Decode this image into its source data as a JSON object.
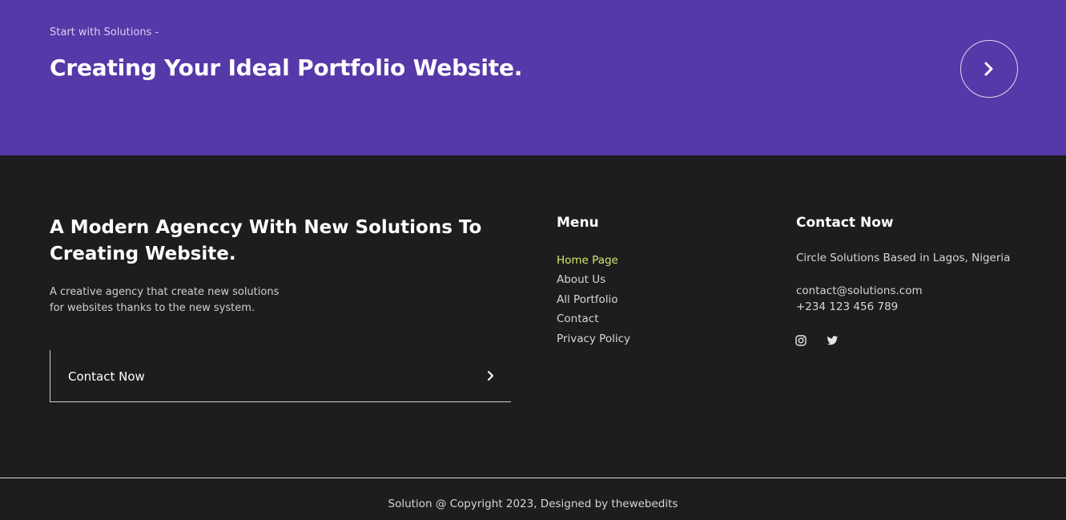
{
  "cta": {
    "eyebrow": "Start with Solutions -",
    "title": "Creating Your Ideal Portfolio Website.",
    "arrow_icon": "chevron-right-icon",
    "background_color": "#5539a8"
  },
  "about": {
    "title": "A Modern Agenccy With New Solutions To Creating Website.",
    "text_line1": "A creative agency that create new solutions",
    "text_line2": "for websites thanks to the new system.",
    "button_label": "Contact Now",
    "button_icon": "chevron-right-icon"
  },
  "menu": {
    "title": "Menu",
    "items": [
      {
        "label": "Home Page",
        "active": true
      },
      {
        "label": "About Us",
        "active": false
      },
      {
        "label": "All Portfolio",
        "active": false
      },
      {
        "label": "Contact",
        "active": false
      },
      {
        "label": "Privacy Policy",
        "active": false
      }
    ],
    "active_color": "#d4e86a"
  },
  "contact": {
    "title": "Contact Now",
    "address": "Circle Solutions Based in Lagos, Nigeria",
    "email": "contact@solutions.com",
    "phone": "+234 123 456 789",
    "social": [
      "instagram-icon",
      "twitter-icon"
    ]
  },
  "footer": {
    "copyright": "Solution @ Copyright 2023, Designed by thewebedits",
    "background_color": "#1d1d1d"
  }
}
